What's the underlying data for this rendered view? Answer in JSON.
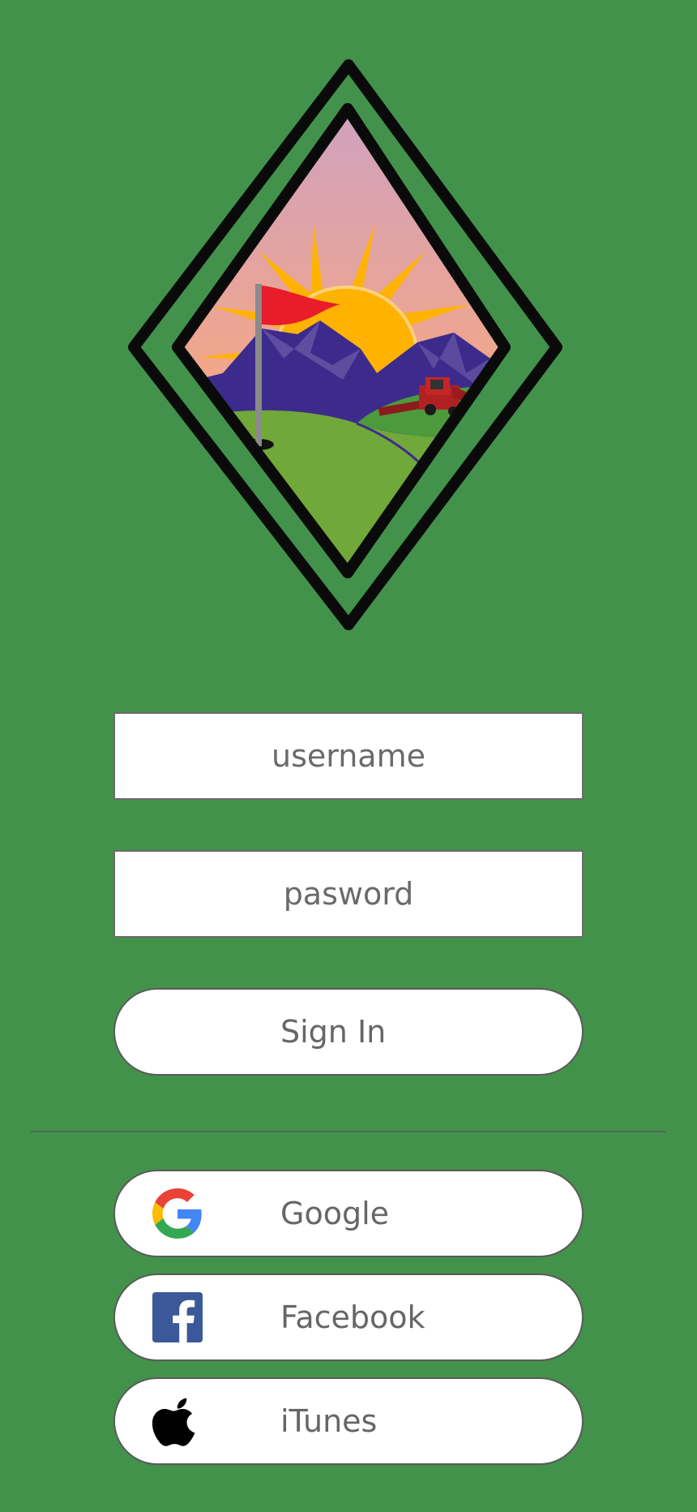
{
  "app": {
    "background_color": "#43924b",
    "logo": {
      "name": "golf-flag-mountain-harvester-logo"
    }
  },
  "login": {
    "username_placeholder": "username",
    "password_placeholder": "pasword",
    "sign_in_label": "Sign In"
  },
  "social": {
    "google": {
      "label": "Google",
      "icon": "google-icon"
    },
    "facebook": {
      "label": "Facebook",
      "icon": "facebook-icon",
      "color": "#3b5998"
    },
    "itunes": {
      "label": "iTunes",
      "icon": "apple-icon"
    }
  }
}
